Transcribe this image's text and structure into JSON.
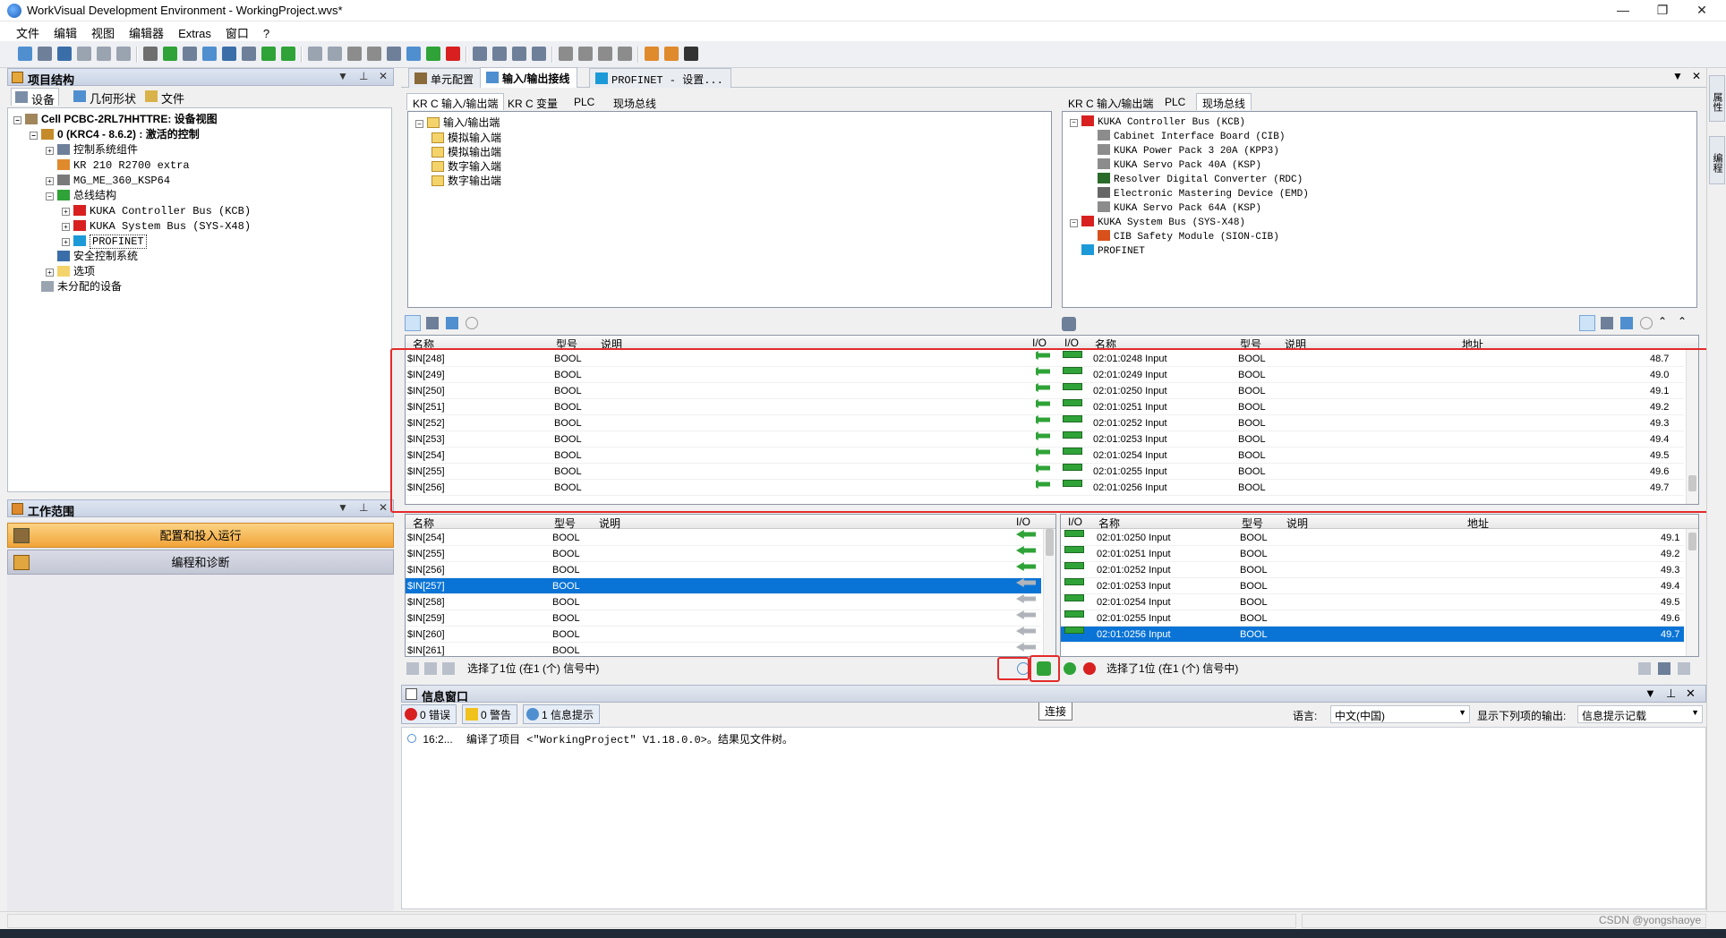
{
  "window": {
    "title": "WorkVisual Development Environment - WorkingProject.wvs*",
    "minimize": "—",
    "maximize": "❐",
    "close": "✕"
  },
  "menu": [
    "文件",
    "编辑",
    "视图",
    "编辑器",
    "Extras",
    "窗口",
    "?"
  ],
  "project_panel": {
    "title": "项目结构",
    "tabs": [
      "设备",
      "几何形状",
      "文件"
    ],
    "tree": [
      {
        "label": "Cell PCBC-2RL7HHTTRE: 设备视图",
        "depth": 0,
        "exp": "−",
        "bold": true,
        "icon": "cell-icon"
      },
      {
        "label": "0 (KRC4 - 8.6.2) : 激活的控制",
        "depth": 1,
        "exp": "−",
        "bold": true,
        "icon": "controller-icon"
      },
      {
        "label": "控制系统组件",
        "depth": 2,
        "exp": "+",
        "icon": "components-icon"
      },
      {
        "label": "KR 210 R2700 extra",
        "depth": 2,
        "exp": "",
        "icon": "robot-icon",
        "mono": true
      },
      {
        "label": "MG_ME_360_KSP64",
        "depth": 2,
        "exp": "+",
        "icon": "motor-icon",
        "mono": true
      },
      {
        "label": "总线结构",
        "depth": 2,
        "exp": "−",
        "icon": "bus-icon"
      },
      {
        "label": "KUKA Controller Bus (KCB)",
        "depth": 3,
        "exp": "+",
        "icon": "kcb-icon",
        "mono": true
      },
      {
        "label": "KUKA System Bus (SYS-X48)",
        "depth": 3,
        "exp": "+",
        "icon": "sysbus-icon",
        "mono": true
      },
      {
        "label": "PROFINET",
        "depth": 3,
        "exp": "+",
        "icon": "profinet-icon",
        "mono": true,
        "boxed": true
      },
      {
        "label": "安全控制系统",
        "depth": 2,
        "exp": "",
        "icon": "safety-icon"
      },
      {
        "label": "选项",
        "depth": 2,
        "exp": "+",
        "icon": "folder-icon"
      },
      {
        "label": "未分配的设备",
        "depth": 1,
        "exp": "",
        "icon": "unassigned-icon"
      }
    ]
  },
  "work_panel": {
    "title": "工作范围",
    "items": [
      "配置和投入运行",
      "编程和诊断"
    ]
  },
  "doc_tabs": [
    "单元配置",
    "输入/输出接线",
    "PROFINET - 设置..."
  ],
  "left_io_tabs": [
    "KR C 输入/输出端",
    "KR C 变量",
    "PLC",
    "现场总线"
  ],
  "left_io_tree": {
    "root": "输入/输出端",
    "children": [
      "模拟输入端",
      "模拟输出端",
      "数字输入端",
      "数字输出端"
    ]
  },
  "right_io_tabs": [
    "KR C 输入/输出端",
    "PLC",
    "现场总线"
  ],
  "right_io_tree": [
    {
      "label": "KUKA Controller Bus (KCB)",
      "depth": 0,
      "exp": "−",
      "icon": "kcb-icon"
    },
    {
      "label": "Cabinet Interface Board (CIB)",
      "depth": 1,
      "icon": "device-icon"
    },
    {
      "label": "KUKA Power Pack 3 20A (KPP3)",
      "depth": 1,
      "icon": "device-icon"
    },
    {
      "label": "KUKA Servo Pack 40A (KSP)",
      "depth": 1,
      "icon": "device-icon"
    },
    {
      "label": "Resolver Digital Converter (RDC)",
      "depth": 1,
      "icon": "rdc-icon"
    },
    {
      "label": "Electronic Mastering Device (EMD)",
      "depth": 1,
      "icon": "emd-icon"
    },
    {
      "label": "KUKA Servo Pack 64A (KSP)",
      "depth": 1,
      "icon": "device-icon"
    },
    {
      "label": "KUKA System Bus (SYS-X48)",
      "depth": 0,
      "exp": "−",
      "icon": "sysbus-icon"
    },
    {
      "label": "CIB Safety Module (SION-CIB)",
      "depth": 1,
      "icon": "safety-module-icon"
    },
    {
      "label": "PROFINET",
      "depth": 0,
      "icon": "profinet-icon"
    }
  ],
  "top_grid": {
    "headers": [
      "名称",
      "型号",
      "说明",
      "I/O",
      "I/O",
      "名称",
      "型号",
      "说明",
      "地址"
    ],
    "rows": [
      {
        "name": "$IN[248]",
        "type": "BOOL",
        "rname": "02:01:0248 Input",
        "rtype": "BOOL",
        "addr": "48.7"
      },
      {
        "name": "$IN[249]",
        "type": "BOOL",
        "rname": "02:01:0249 Input",
        "rtype": "BOOL",
        "addr": "49.0"
      },
      {
        "name": "$IN[250]",
        "type": "BOOL",
        "rname": "02:01:0250 Input",
        "rtype": "BOOL",
        "addr": "49.1"
      },
      {
        "name": "$IN[251]",
        "type": "BOOL",
        "rname": "02:01:0251 Input",
        "rtype": "BOOL",
        "addr": "49.2"
      },
      {
        "name": "$IN[252]",
        "type": "BOOL",
        "rname": "02:01:0252 Input",
        "rtype": "BOOL",
        "addr": "49.3"
      },
      {
        "name": "$IN[253]",
        "type": "BOOL",
        "rname": "02:01:0253 Input",
        "rtype": "BOOL",
        "addr": "49.4"
      },
      {
        "name": "$IN[254]",
        "type": "BOOL",
        "rname": "02:01:0254 Input",
        "rtype": "BOOL",
        "addr": "49.5"
      },
      {
        "name": "$IN[255]",
        "type": "BOOL",
        "rname": "02:01:0255 Input",
        "rtype": "BOOL",
        "addr": "49.6"
      },
      {
        "name": "$IN[256]",
        "type": "BOOL",
        "rname": "02:01:0256 Input",
        "rtype": "BOOL",
        "addr": "49.7"
      }
    ]
  },
  "bottom_left_grid": {
    "headers": [
      "名称",
      "型号",
      "说明",
      "I/O"
    ],
    "rows": [
      {
        "name": "$IN[254]",
        "type": "BOOL",
        "mapped": true
      },
      {
        "name": "$IN[255]",
        "type": "BOOL",
        "mapped": true
      },
      {
        "name": "$IN[256]",
        "type": "BOOL",
        "mapped": true
      },
      {
        "name": "$IN[257]",
        "type": "BOOL",
        "mapped": false,
        "selected": true
      },
      {
        "name": "$IN[258]",
        "type": "BOOL",
        "mapped": false
      },
      {
        "name": "$IN[259]",
        "type": "BOOL",
        "mapped": false
      },
      {
        "name": "$IN[260]",
        "type": "BOOL",
        "mapped": false
      },
      {
        "name": "$IN[261]",
        "type": "BOOL",
        "mapped": false
      }
    ],
    "status": "选择了1位 (在1 (个) 信号中)"
  },
  "bottom_right_grid": {
    "headers": [
      "I/O",
      "名称",
      "型号",
      "说明",
      "地址"
    ],
    "rows": [
      {
        "name": "02:01:0250 Input",
        "type": "BOOL",
        "addr": "49.1"
      },
      {
        "name": "02:01:0251 Input",
        "type": "BOOL",
        "addr": "49.2"
      },
      {
        "name": "02:01:0252 Input",
        "type": "BOOL",
        "addr": "49.3"
      },
      {
        "name": "02:01:0253 Input",
        "type": "BOOL",
        "addr": "49.4"
      },
      {
        "name": "02:01:0254 Input",
        "type": "BOOL",
        "addr": "49.5"
      },
      {
        "name": "02:01:0255 Input",
        "type": "BOOL",
        "addr": "49.6"
      },
      {
        "name": "02:01:0256 Input",
        "type": "BOOL",
        "addr": "49.7",
        "selected": true
      }
    ],
    "status": "选择了1位 (在1 (个) 信号中)"
  },
  "tooltip": "连接",
  "info_window": {
    "title": "信息窗口",
    "errors": "0 错误",
    "warnings": "0 警告",
    "hints": "1 信息提示",
    "language_label": "语言:",
    "language_value": "中文(中国)",
    "output_label": "显示下列项的输出:",
    "output_value": "信息提示记载",
    "message_time": "16:2...",
    "message_text": "编译了项目 <\"WorkingProject\" V1.18.0.0>。结果见文件树。"
  },
  "right_strip": [
    "属性",
    "编程"
  ],
  "watermark": "CSDN @yongshaoye",
  "colors": {
    "selection": "#0a74d6",
    "highlight_red": "#e42a2a",
    "work_active": "#f6b54a",
    "mapped_green": "#2fa337"
  }
}
